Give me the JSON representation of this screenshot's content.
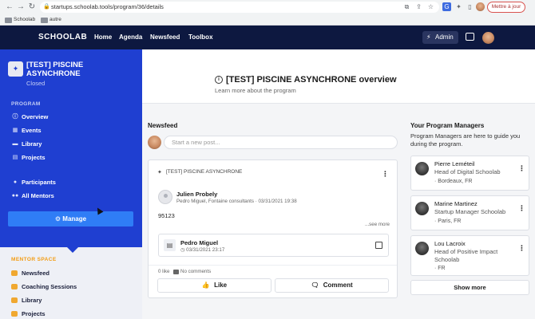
{
  "browser": {
    "url": "startups.schoolab.tools/program/36/details",
    "update_label": "Mettre à jour",
    "bookmarks": [
      "Schoolab",
      "autre"
    ]
  },
  "header": {
    "logo": "SCHOOLAB",
    "nav": [
      "Home",
      "Agenda",
      "Newsfeed",
      "Toolbox"
    ],
    "admin_label": "Admin"
  },
  "sidebar": {
    "program_title": "[TEST] PISCINE ASYNCHRONE",
    "program_status": "Closed",
    "section_program": "PROGRAM",
    "program_items": [
      {
        "label": "Overview",
        "icon": "info-icon"
      },
      {
        "label": "Events",
        "icon": "calendar-icon"
      },
      {
        "label": "Library",
        "icon": "folder-icon"
      },
      {
        "label": "Projects",
        "icon": "file-icon"
      }
    ],
    "people_items": [
      {
        "label": "Participants",
        "icon": "person-icon"
      },
      {
        "label": "All Mentors",
        "icon": "people-icon"
      }
    ],
    "manage_label": "Manage",
    "mentor_space_label": "MENTOR SPACE",
    "mentor_items": [
      {
        "label": "Newsfeed"
      },
      {
        "label": "Coaching Sessions"
      },
      {
        "label": "Library"
      },
      {
        "label": "Projects"
      }
    ]
  },
  "overview": {
    "title": "[TEST] PISCINE ASYNCHRONE overview",
    "subtitle": "Learn more about the program"
  },
  "newsfeed": {
    "heading": "Newsfeed",
    "placeholder": "Start a new post...",
    "post": {
      "program": "[TEST] PISCINE ASYNCHRONE",
      "author": "Julien Probely",
      "meta": "Pedro Miguel, Fontaine consultants · 03/31/2021 19:38",
      "body": "95123",
      "see_more": "...see more",
      "attachment_name": "Pedro Miguel",
      "attachment_date": "03/31/2021 23:17",
      "likes": "0 like",
      "comments": "No comments",
      "like_label": "Like",
      "comment_label": "Comment"
    }
  },
  "managers": {
    "heading": "Your Program Managers",
    "description": "Program Managers are here to guide you during the program.",
    "list": [
      {
        "name": "Pierre Leméteil",
        "role": "Head of Digital Schoolab",
        "location": "· Bordeaux, FR"
      },
      {
        "name": "Marine Martinez",
        "role": "Startup Manager Schoolab",
        "location": "· Paris, FR"
      },
      {
        "name": "Lou Lacroix",
        "role": "Head of Positive Impact Schoolab",
        "location": "· FR"
      }
    ],
    "show_more": "Show more"
  }
}
